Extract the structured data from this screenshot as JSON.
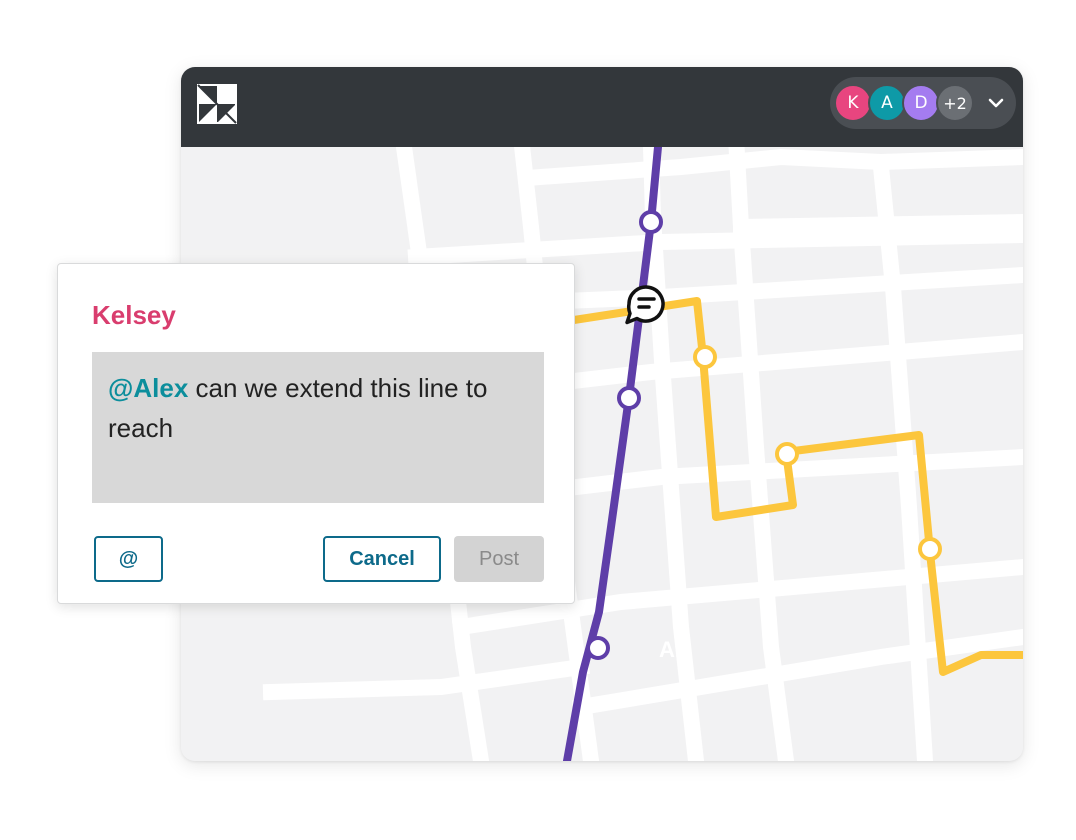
{
  "header": {
    "logo": "app-logo",
    "collaborators": [
      {
        "initial": "K",
        "color": "#e8457f"
      },
      {
        "initial": "A",
        "color": "#0e9aa7"
      },
      {
        "initial": "D",
        "color": "#a47cf0"
      }
    ],
    "overflow_count": "+2",
    "overflow_color": "#6b6f74",
    "menu_icon": "chevron-down-icon"
  },
  "map": {
    "district_label": "AF",
    "lines": [
      {
        "name": "",
        "color": "#5e3ea8"
      },
      {
        "name": "",
        "color": "#fcc63d"
      }
    ],
    "comment_pin_icon": "comment-bubble-icon"
  },
  "comment": {
    "author": "Kelsey",
    "author_color": "#d93d6e",
    "mention": "@Alex",
    "text": " can we extend this line to reach",
    "mention_button_label": "@",
    "cancel_label": "Cancel",
    "post_label": "Post"
  }
}
